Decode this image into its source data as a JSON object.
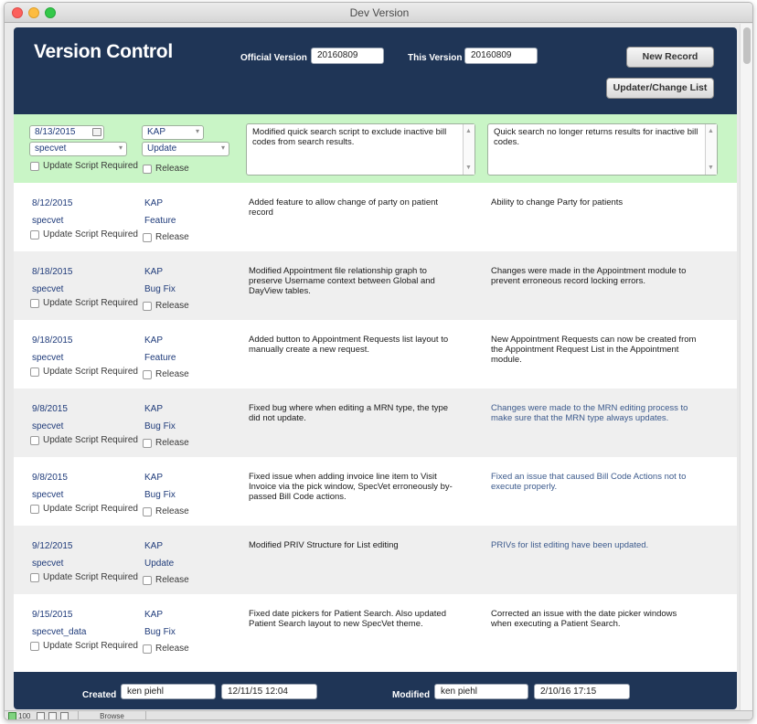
{
  "window": {
    "title": "Dev Version"
  },
  "header": {
    "title": "Version Control",
    "official_label": "Official Version",
    "official_value": "20160809",
    "this_label": "This Version",
    "this_value": "20160809",
    "new_record": "New Record",
    "change_list": "Updater/Change List"
  },
  "active": {
    "date": "8/13/2015",
    "initials": "KAP",
    "user": "specvet",
    "type": "Update",
    "script_label": "Update Script Required",
    "release_label": "Release",
    "description": "Modified quick search script to exclude inactive bill codes from search results.",
    "note": "Quick search no longer returns results for inactive bill codes."
  },
  "rows": [
    {
      "date": "8/12/2015",
      "initials": "KAP",
      "user": "specvet",
      "type": "Feature",
      "script_label": "Update Script Required",
      "release_label": "Release",
      "description": "Added feature to allow change of party on patient record",
      "note": "Ability to change Party for patients"
    },
    {
      "date": "8/18/2015",
      "initials": "KAP",
      "user": "specvet",
      "type": "Bug Fix",
      "script_label": "Update Script Required",
      "release_label": "Release",
      "description": "Modified Appointment file relationship graph to preserve Username context between Global and DayView tables.",
      "note": "Changes were made in the Appointment module to prevent erroneous record locking errors."
    },
    {
      "date": "9/18/2015",
      "initials": "KAP",
      "user": "specvet",
      "type": "Feature",
      "script_label": "Update Script Required",
      "release_label": "Release",
      "description": "Added button to Appointment Requests  list layout to manually create a new request.",
      "note": "New Appointment Requests can now be created from the Appointment Request List in the Appointment module."
    },
    {
      "date": "9/8/2015",
      "initials": "KAP",
      "user": "specvet",
      "type": "Bug Fix",
      "script_label": "Update Script Required",
      "release_label": "Release",
      "description": "Fixed bug where when editing a MRN type, the type did not update.",
      "note": "Changes were made to the MRN editing process to make sure that the MRN type always updates."
    },
    {
      "date": "9/8/2015",
      "initials": "KAP",
      "user": "specvet",
      "type": "Bug Fix",
      "script_label": "Update Script Required",
      "release_label": "Release",
      "description": "Fixed issue when adding invoice line item to Visit Invoice via the pick window, SpecVet erroneously by-passed Bill Code actions.",
      "note": "Fixed an issue that caused Bill Code Actions not to execute properly."
    },
    {
      "date": "9/12/2015",
      "initials": "KAP",
      "user": "specvet",
      "type": "Update",
      "script_label": "Update Script Required",
      "release_label": "Release",
      "description": "Modified PRIV Structure for List editing",
      "note": "PRIVs for list editing have been updated."
    },
    {
      "date": "9/15/2015",
      "initials": "KAP",
      "user": "specvet_data",
      "type": "Bug Fix",
      "script_label": "Update Script Required",
      "release_label": "Release",
      "description": "Fixed date pickers for Patient Search. Also updated Patient Search layout to new SpecVet theme.",
      "note": "Corrected an issue with the date picker windows when executing a Patient Search."
    }
  ],
  "footer": {
    "created_label": "Created",
    "created_by": "ken piehl",
    "created_at": "12/11/15 12:04",
    "modified_label": "Modified",
    "modified_by": "ken piehl",
    "modified_at": "2/10/16 17:15"
  },
  "statusbar": {
    "zoom": "100",
    "mode": "Browse"
  },
  "colors": {
    "panel": "#1f3556",
    "active_row": "#c9f5c6",
    "alt_row": "#efefef",
    "link_text": "#1f3b7a"
  }
}
